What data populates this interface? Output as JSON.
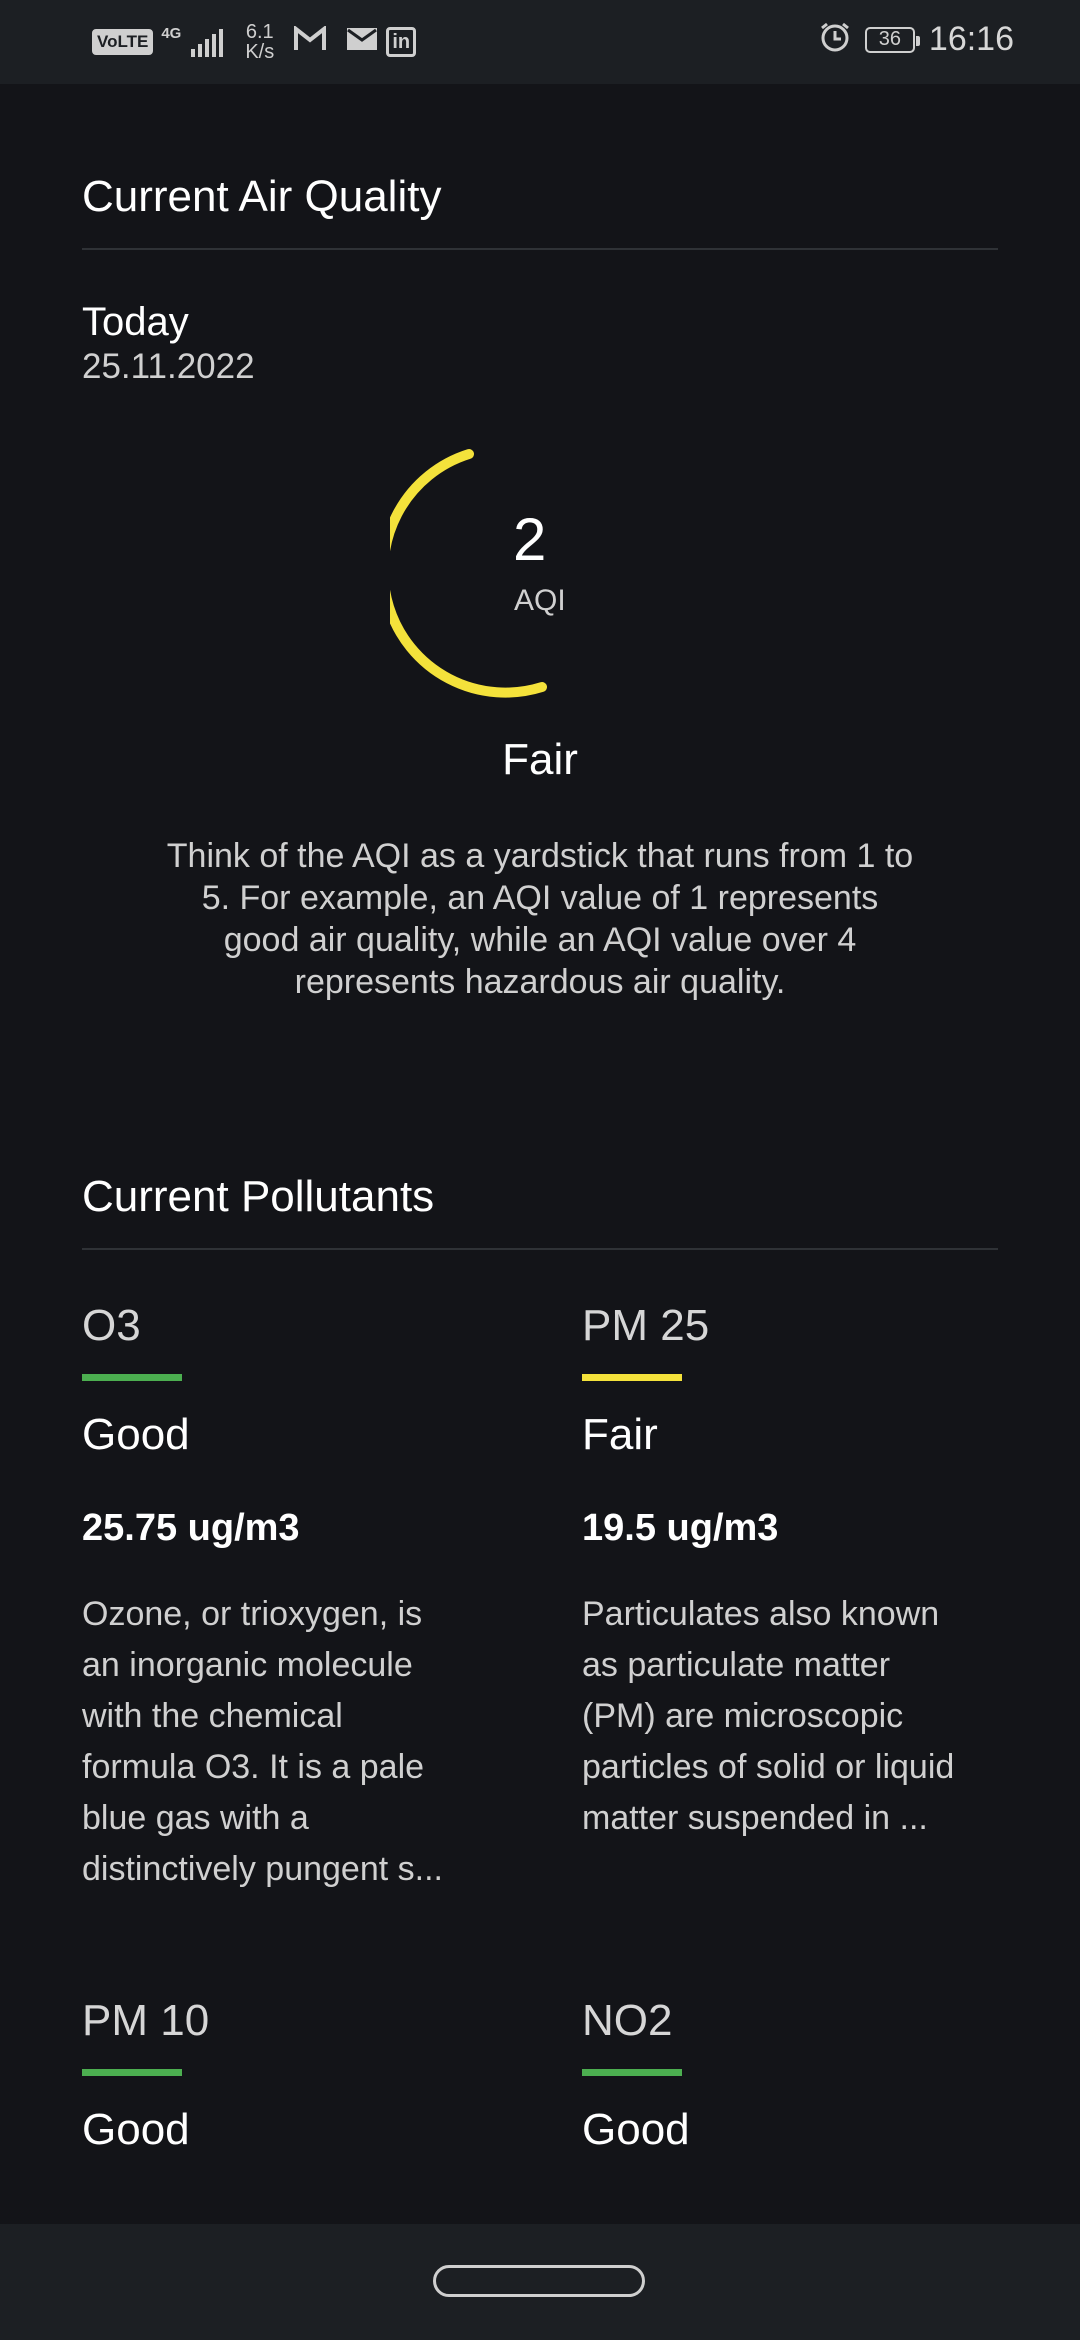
{
  "status_bar": {
    "volte": "VoLTE",
    "network": "4G",
    "speed_value": "6.1",
    "speed_unit": "K/s",
    "battery": "36",
    "time": "16:16"
  },
  "air_quality": {
    "title": "Current Air Quality",
    "day_label": "Today",
    "date": "25.11.2022",
    "aqi_value": "2",
    "aqi_label": "AQI",
    "aqi_scale_max": 5,
    "gauge_color": "#f4e23b",
    "status": "Fair",
    "description": "Think of the AQI as a yardstick that runs from 1 to 5. For example, an AQI value of 1 represents good air quality, while an AQI value over 4 represents hazardous air quality."
  },
  "pollutants": {
    "title": "Current Pollutants",
    "items": [
      {
        "name": "O3",
        "level": "Good",
        "color": "#4caf50",
        "value": "25.75 ug/m3",
        "description": "Ozone, or trioxygen, is an inorganic molecule with the chemical formula O3. It is a pale blue gas with a distinctively pungent s..."
      },
      {
        "name": "PM 25",
        "level": "Fair",
        "color": "#f4e23b",
        "value": "19.5 ug/m3",
        "description": "Particulates also known as particulate matter (PM) are microscopic particles of solid or liquid matter suspended in ..."
      },
      {
        "name": "PM 10",
        "level": "Good",
        "color": "#4caf50"
      },
      {
        "name": "NO2",
        "level": "Good",
        "color": "#4caf50"
      }
    ]
  }
}
